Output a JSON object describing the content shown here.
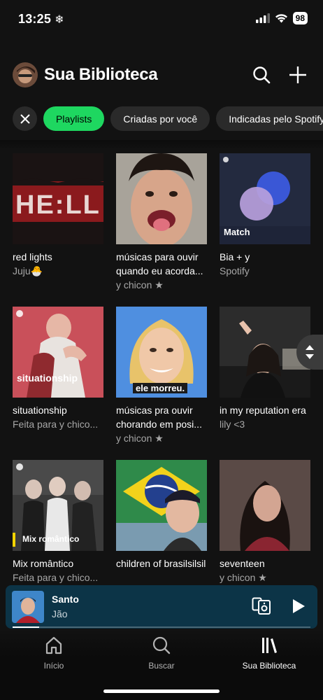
{
  "status_bar": {
    "time": "13:25",
    "time_icon": "snowflake-icon",
    "battery": "98"
  },
  "header": {
    "title": "Sua Biblioteca",
    "icons": [
      "search-icon",
      "plus-icon"
    ]
  },
  "filters": {
    "close_icon": "close-icon",
    "chips": [
      "Playlists",
      "Criadas por você",
      "Indicadas pelo Spotify"
    ],
    "active_chip": "Playlists",
    "colors": {
      "active": "#1ed760",
      "inactive": "#2a2a2a"
    }
  },
  "playlists": [
    {
      "title": "red lights",
      "subtitle": "Juju🐣",
      "cover_text": "HE:LL"
    },
    {
      "title": "músicas para ouvir quando eu acorda...",
      "subtitle": "y chicon ★"
    },
    {
      "title": "Bia + y",
      "subtitle": "Spotify",
      "cover_text": "Match"
    },
    {
      "title": "situationship",
      "subtitle": "Feita para y chico...",
      "cover_text": "situationship"
    },
    {
      "title": "músicas pra ouvir chorando em posi...",
      "subtitle": "y chicon ★",
      "cover_text": "ele morreu."
    },
    {
      "title": "in my reputation era",
      "subtitle": "lily <3"
    },
    {
      "title": "Mix romântico",
      "subtitle": "Feita para y chico...",
      "cover_text": "Mix romântico"
    },
    {
      "title": "children of brasilsilsil",
      "subtitle": ""
    },
    {
      "title": "seventeen",
      "subtitle": "y chicon ★"
    }
  ],
  "now_playing": {
    "title": "Santo",
    "artist": "Jão",
    "progress": 0.09,
    "color": "#0c3447"
  },
  "bottom_nav": {
    "items": [
      {
        "label": "Início",
        "icon": "home-icon"
      },
      {
        "label": "Buscar",
        "icon": "search-icon"
      },
      {
        "label": "Sua Biblioteca",
        "icon": "library-icon"
      }
    ],
    "active": "Sua Biblioteca"
  }
}
